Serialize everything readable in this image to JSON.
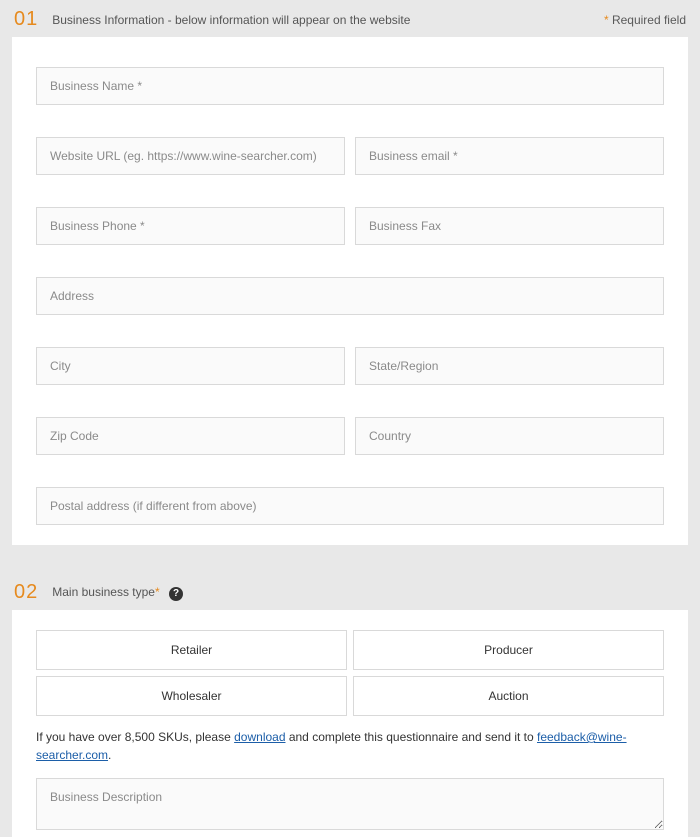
{
  "section1": {
    "num": "01",
    "title": "Business Information - below information will appear on the website",
    "required_hint_star": "*",
    "required_hint_text": " Required field",
    "fields": {
      "business_name": "Business Name *",
      "website_url": "Website URL (eg. https://www.wine-searcher.com)",
      "business_email": "Business email *",
      "business_phone": "Business Phone *",
      "business_fax": "Business Fax",
      "address": "Address",
      "city": "City",
      "state": "State/Region",
      "zip": "Zip Code",
      "country": "Country",
      "postal": "Postal address (if different from above)"
    }
  },
  "section2": {
    "num": "02",
    "title": "Main business type",
    "types": {
      "retailer": "Retailer",
      "producer": "Producer",
      "wholesaler": "Wholesaler",
      "auction": "Auction"
    },
    "note_pre": "If you have over 8,500 SKUs, please ",
    "note_link1": "download",
    "note_mid": " and complete this questionnaire and send it to ",
    "note_link2": "feedback@wine-searcher.com",
    "note_post": ".",
    "description_placeholder": "Business Description"
  }
}
